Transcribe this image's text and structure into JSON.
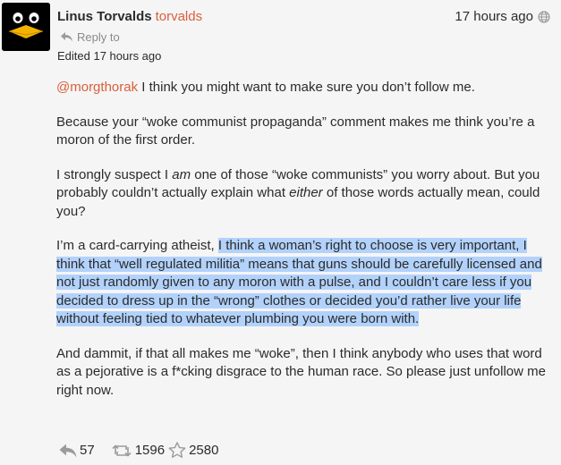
{
  "post": {
    "author": {
      "display_name": "Linus Torvalds",
      "username": "torvalds",
      "avatar_icon": "penguin-avatar-icon"
    },
    "timestamp": "17 hours ago",
    "visibility_icon": "globe-icon",
    "reply_to_label": "Reply to",
    "edited_label": "Edited 17 hours ago",
    "paragraphs": [
      {
        "mention": "@morgthorak",
        "text": " I think you might want to make sure you don’t follow me."
      },
      {
        "text": "Because your “woke communist propaganda” comment makes me think you’re a moron of the first order."
      },
      {
        "part1": "I strongly suspect I ",
        "em1": "am",
        "part2": " one of those “woke communists” you worry about. But you probably couldn’t actually explain what ",
        "em2": "either",
        "part3": " of those words actually mean, could you?"
      },
      {
        "plain": "I’m a card-carrying atheist, ",
        "highlighted": "I think a woman’s right to choose is very important, I think that “well regulated militia” means that guns should be carefully licensed and not just randomly given to any moron with a pulse, and I couldn’t care less if you decided to dress up in the “wrong” clothes or decided you’d rather live your life without feeling tied to whatever plumbing you were born with."
      },
      {
        "text": "And dammit, if that all makes me “woke”, then I think anybody who uses that word as a pejorative is a f*cking disgrace to the human race. So please just unfollow me right now."
      }
    ],
    "actions": {
      "replies": "57",
      "boosts": "1596",
      "favourites": "2580"
    },
    "colors": {
      "accent": "#d95f3c",
      "selection": "#b2d2fb",
      "background": "#f5f5f5"
    }
  }
}
